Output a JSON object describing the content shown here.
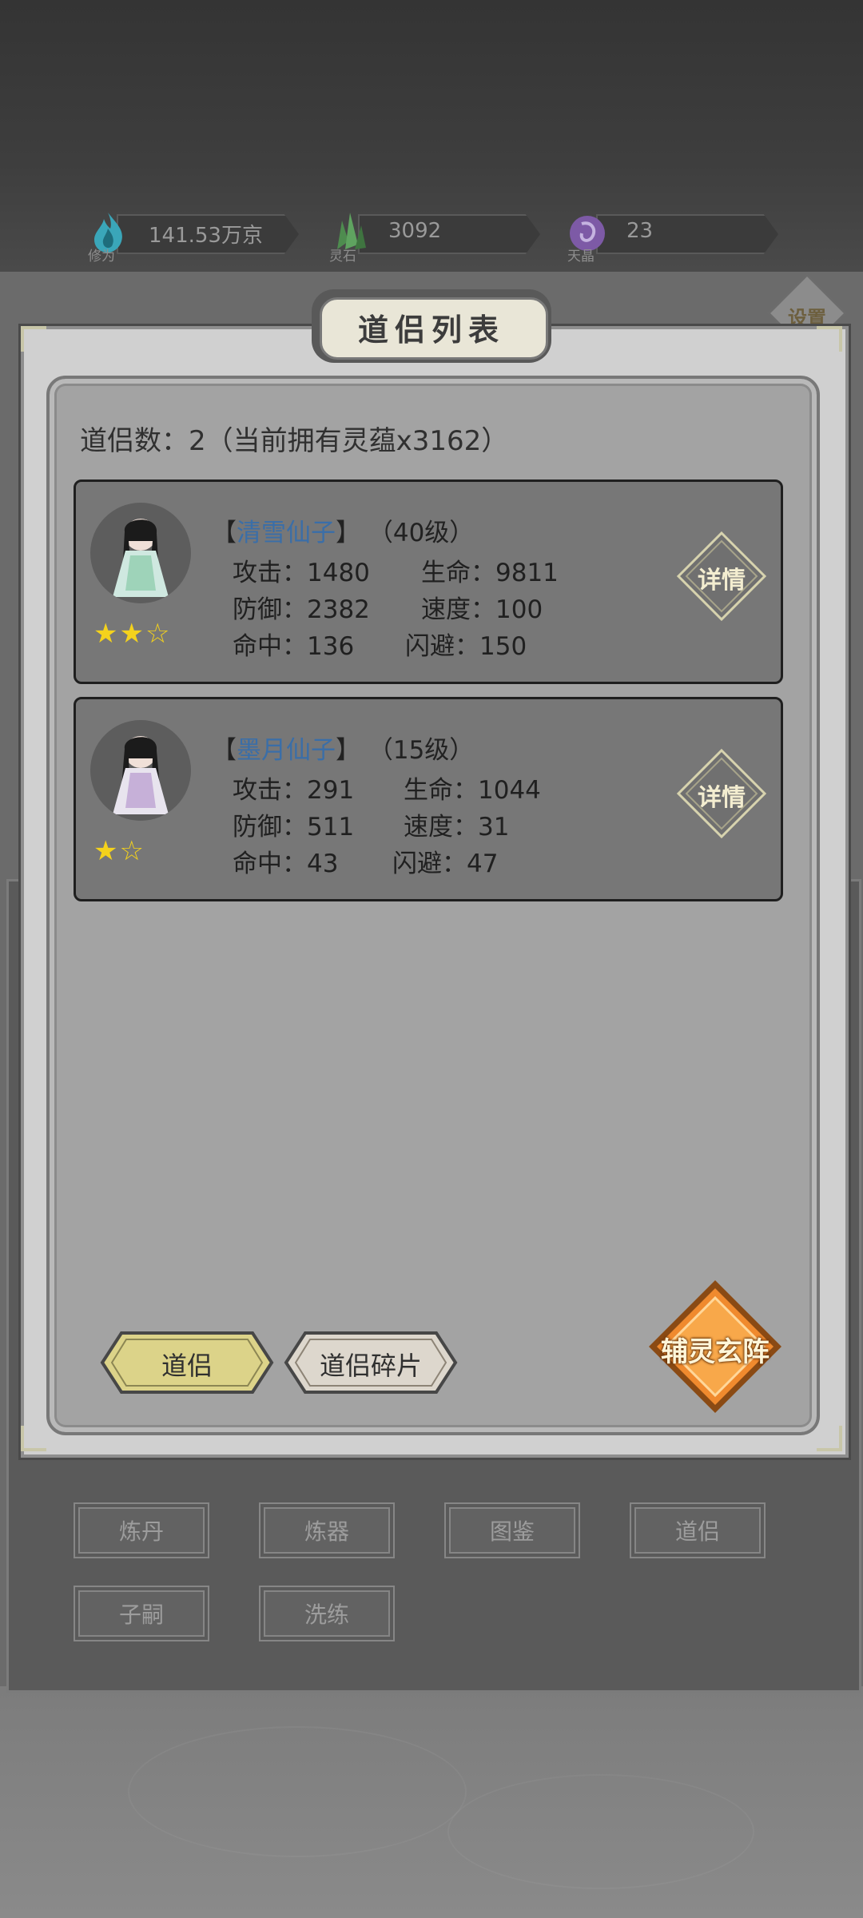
{
  "resources": [
    {
      "label": "修为",
      "value": "141.53万京",
      "color": "#3aa6b9"
    },
    {
      "label": "灵石",
      "value": "3092",
      "color": "#4e8c4f"
    },
    {
      "label": "天晶",
      "value": "23",
      "color": "#7d5aa6"
    }
  ],
  "settings_label": "设置",
  "dialog": {
    "title": "道侣列表",
    "count_text": "道侣数：2（当前拥有灵蕴x3162）"
  },
  "companions": [
    {
      "name_prefix": "【",
      "name": "清雪仙子",
      "name_suffix": "】",
      "level": "（40级）",
      "attack": "攻击：1480",
      "hp": "生命：9811",
      "defense": "防御：2382",
      "speed": "速度：100",
      "hit": "命中：136",
      "dodge": "闪避：150",
      "stars": "★★☆",
      "detail_label": "详情"
    },
    {
      "name_prefix": "【",
      "name": "墨月仙子",
      "name_suffix": "】",
      "level": "（15级）",
      "attack": "攻击：291",
      "hp": "生命：1044",
      "defense": "防御：511",
      "speed": "速度：31",
      "hit": "命中：43",
      "dodge": "闪避：47",
      "stars": "★☆",
      "detail_label": "详情"
    }
  ],
  "tabs": [
    {
      "label": "道侣",
      "active": true
    },
    {
      "label": "道侣碎片",
      "active": false
    }
  ],
  "formation_label": "辅灵玄阵",
  "back_menu": [
    "炼丹",
    "炼器",
    "图鉴",
    "道侣",
    "子嗣",
    "洗练"
  ]
}
